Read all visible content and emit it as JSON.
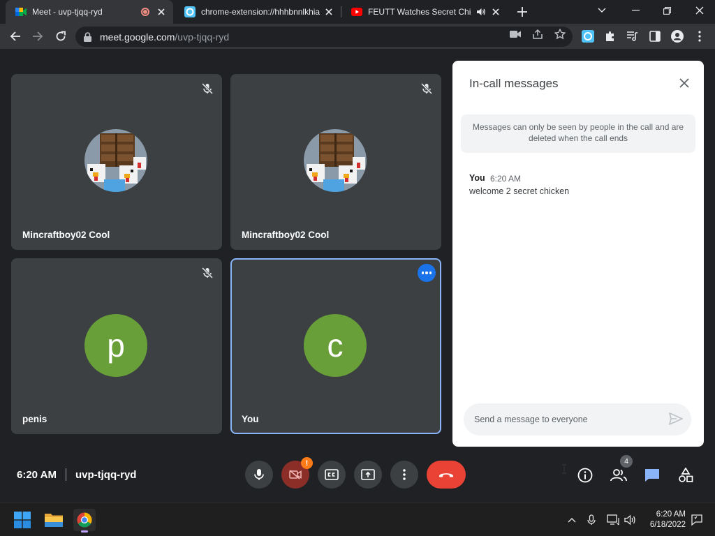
{
  "browser": {
    "tabs": [
      {
        "title": "Meet - uvp-tjqq-ryd",
        "favicon": "google-meet-icon",
        "recording": true,
        "active": true
      },
      {
        "title": "chrome-extension://hhhbnnlkhia",
        "favicon": "extension-icon",
        "active": false
      },
      {
        "title": "FEUTT Watches Secret Chick",
        "favicon": "youtube-icon",
        "audio": true,
        "active": false
      }
    ],
    "new_tab_label": "+",
    "url_host": "meet.google.com",
    "url_path": "/uvp-tjqq-ryd"
  },
  "meeting": {
    "participants": [
      {
        "name": "Mincraftboy02 Cool",
        "avatar": "minecraft-chicken-image",
        "muted": true
      },
      {
        "name": "Mincraftboy02 Cool",
        "avatar": "minecraft-chicken-image",
        "muted": true
      },
      {
        "name": "penis",
        "avatar_letter": "p",
        "muted": true
      },
      {
        "name": "You",
        "avatar_letter": "c",
        "muted": false,
        "selected": true
      }
    ],
    "avatar_color": "#689f38"
  },
  "chat": {
    "title": "In-call messages",
    "notice": "Messages can only be seen by people in the call and are deleted when the call ends",
    "messages": [
      {
        "sender": "You",
        "time": "6:20 AM",
        "text": "welcome 2 secret chicken"
      }
    ],
    "compose_placeholder": "Send a message to everyone"
  },
  "bottom_bar": {
    "time": "6:20 AM",
    "meeting_code": "uvp-tjqq-ryd",
    "camera_warning": "!",
    "people_count": "4"
  },
  "taskbar": {
    "time": "6:20 AM",
    "date": "6/18/2022"
  },
  "colors": {
    "meet_bg": "#202124",
    "tile_bg": "#3c4043",
    "hangup_red": "#ea4335",
    "accent_blue": "#8ab4f8"
  }
}
